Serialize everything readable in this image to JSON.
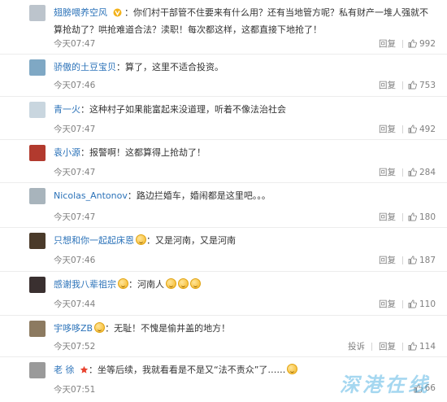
{
  "labels": {
    "reply": "回复",
    "report": "投诉"
  },
  "comments": [
    {
      "username": "翅膀喂养空风",
      "badge": "v-badge",
      "text": "你们村干部管不住要来有什么用？还有当地管方呢？私有财产一堆人强就不算抢劫了？哄抢难道合法？渎职！每次都这样，这都直接下地抢了！",
      "time": "今天07:47",
      "likes": "992",
      "report": false,
      "avatar_color": "#bcc4cc"
    },
    {
      "username": "骄傲的土豆宝贝",
      "text": "算了，这里不适合投资。",
      "time": "今天07:46",
      "likes": "753",
      "report": false,
      "avatar_color": "#7fa8c4"
    },
    {
      "username": "青一火",
      "text": "这种村子如果能富起来没道理，听着不像法治社会",
      "time": "今天07:47",
      "likes": "492",
      "report": false,
      "avatar_color": "#c9d6df"
    },
    {
      "username": "袁小源",
      "text": "报警啊！这都算得上抢劫了！",
      "time": "今天07:47",
      "likes": "284",
      "report": false,
      "avatar_color": "#b23a2e"
    },
    {
      "username": "Nicolas_Antonov",
      "text": "路边拦婚车，婚闹都是这里吧。。。",
      "time": "今天07:47",
      "likes": "180",
      "report": false,
      "avatar_color": "#a8b4bc"
    },
    {
      "username": "只想和你一起起床恩",
      "badge": "emoji",
      "text": "又是河南，又是河南",
      "time": "今天07:46",
      "likes": "187",
      "report": false,
      "avatar_color": "#4a3a2a"
    },
    {
      "username": "感谢我八辈祖宗",
      "badge": "emoji",
      "text": "河南人",
      "emojis": 3,
      "time": "今天07:44",
      "likes": "110",
      "report": false,
      "avatar_color": "#3a3030"
    },
    {
      "username": "宇哆哆ZB",
      "badge": "emoji",
      "text": "无耻！不愧是偷井盖的地方！",
      "time": "今天07:52",
      "likes": "114",
      "report": true,
      "avatar_color": "#8c7a60"
    },
    {
      "username": "老 徐",
      "badge": "star",
      "text": "坐等后续，我就看看是不是又“法不责众”了……",
      "emojis": 1,
      "time": "今天07:51",
      "likes": "66",
      "report": false,
      "avatar_color": "#9a9a9a"
    }
  ],
  "watermark": "深港在线",
  "colors": {
    "username": "#2c73b9",
    "meta": "#808080",
    "divider": "#ececec",
    "watermark": "#3aa7e0"
  }
}
